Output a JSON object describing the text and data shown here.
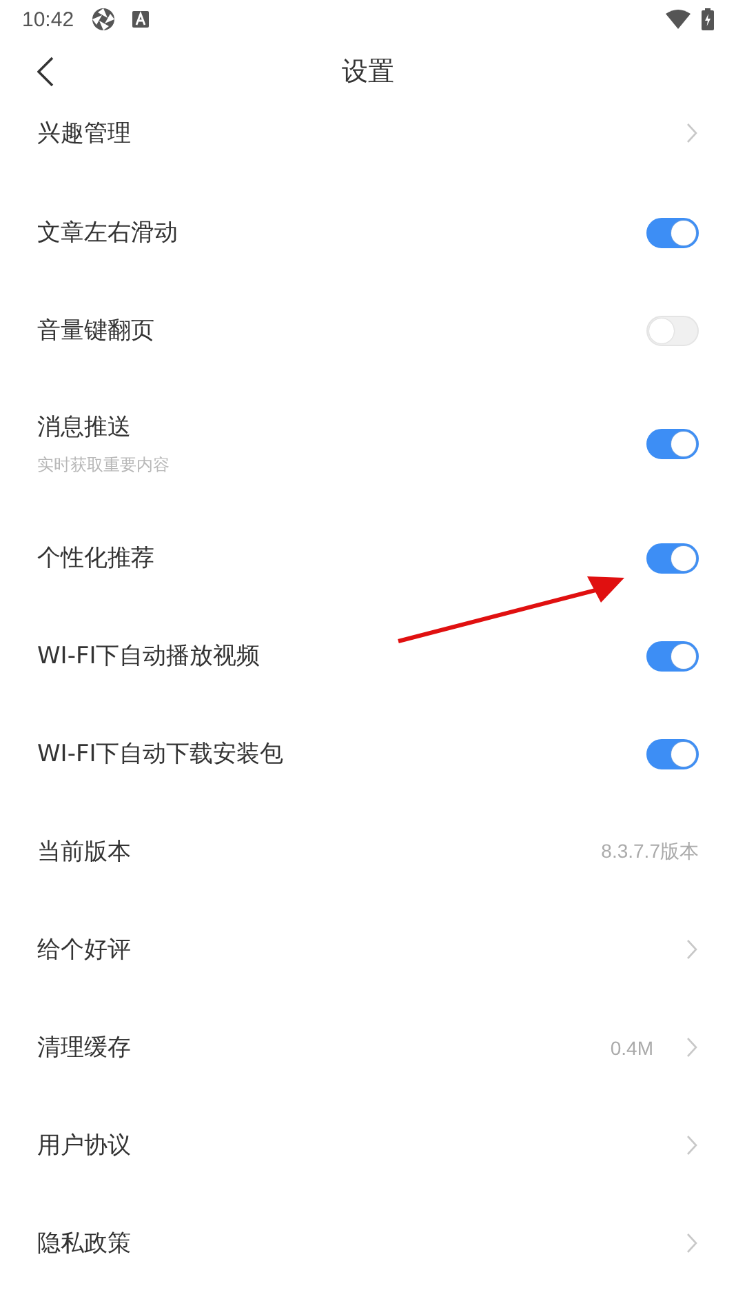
{
  "status_bar": {
    "time": "10:42"
  },
  "header": {
    "title": "设置"
  },
  "rows": [
    {
      "kind": "link",
      "label": "兴趣管理"
    },
    {
      "kind": "toggle",
      "label": "文章左右滑动",
      "on": true
    },
    {
      "kind": "toggle",
      "label": "音量键翻页",
      "on": false
    },
    {
      "kind": "toggle",
      "label": "消息推送",
      "subtitle": "实时获取重要内容",
      "on": true
    },
    {
      "kind": "toggle",
      "label": "个性化推荐",
      "on": true
    },
    {
      "kind": "toggle",
      "label": "WI-FI下自动播放视频",
      "on": true
    },
    {
      "kind": "toggle",
      "label": "WI-FI下自动下载安装包",
      "on": true
    },
    {
      "kind": "value",
      "label": "当前版本",
      "value": "8.3.7.7版本"
    },
    {
      "kind": "link",
      "label": "给个好评"
    },
    {
      "kind": "link",
      "label": "清理缓存",
      "value": "0.4M"
    },
    {
      "kind": "link",
      "label": "用户协议"
    },
    {
      "kind": "link",
      "label": "隐私政策"
    }
  ]
}
